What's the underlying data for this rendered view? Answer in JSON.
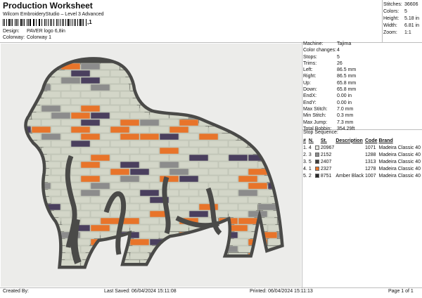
{
  "header": {
    "title": "Production Worksheet",
    "subtitle": "Wilcom EmbroideryStudio – Level 3 Advanced",
    "barcode_tail": ",1",
    "design_label": "Design:",
    "design_value": "PAVER logo 6,8in",
    "colorway_label": "Colorway:",
    "colorway_value": "Colorway 1"
  },
  "stats": [
    {
      "label": "Stitches:",
      "value": "36606"
    },
    {
      "label": "Colors:",
      "value": "5"
    },
    {
      "label": "Height:",
      "value": "5.18 in"
    },
    {
      "label": "Width:",
      "value": "6.81 in"
    },
    {
      "label": "Zoom:",
      "value": "1:1"
    }
  ],
  "machine_info": [
    {
      "label": "Machine:",
      "value": "Tajima"
    },
    {
      "label": "Color changes:",
      "value": "4"
    },
    {
      "label": "Stops:",
      "value": "5"
    },
    {
      "label": "Trims:",
      "value": "26"
    },
    {
      "label": "Left:",
      "value": "86.5 mm"
    },
    {
      "label": "Right:",
      "value": "86.5 mm"
    },
    {
      "label": "Up:",
      "value": "65.8 mm"
    },
    {
      "label": "Down:",
      "value": "65.8 mm"
    },
    {
      "label": "EndX:",
      "value": "0.00 in"
    },
    {
      "label": "EndY:",
      "value": "0.00 in"
    },
    {
      "label": "Max Stitch:",
      "value": "7.0 mm"
    },
    {
      "label": "Min Stitch:",
      "value": "0.3 mm"
    },
    {
      "label": "Max Jump:",
      "value": "7.3 mm"
    },
    {
      "label": "Total Bobbin:",
      "value": "354.29ft"
    }
  ],
  "stop_sequence": {
    "title": "Stop Sequence:",
    "columns": [
      "#",
      "N.",
      "St.",
      "Description",
      "Code",
      "Brand"
    ],
    "rows": [
      {
        "num": "1.",
        "n": "4",
        "color": "#e6e6e0",
        "st": "20967",
        "desc": "",
        "code": "1071",
        "brand": "Madeira Classic 40"
      },
      {
        "num": "2.",
        "n": "3",
        "color": "#8c8c8c",
        "st": "2152",
        "desc": "",
        "code": "1288",
        "brand": "Madeira Classic 40"
      },
      {
        "num": "3.",
        "n": "5",
        "color": "#3d3d3d",
        "st": "2407",
        "desc": "",
        "code": "1313",
        "brand": "Madeira Classic 40"
      },
      {
        "num": "4.",
        "n": "1",
        "color": "#e8742a",
        "st": "2327",
        "desc": "",
        "code": "1278",
        "brand": "Madeira Classic 40"
      },
      {
        "num": "5.",
        "n": "2",
        "color": "#2a2a2a",
        "st": "8751",
        "desc": "Amber Black",
        "code": "1007",
        "brand": "Madeira Classic 40"
      }
    ]
  },
  "footer": {
    "created_by": "Created By:",
    "last_saved": "Last Saved: 06/04/2024 15:11:08",
    "printed": "Printed: 06/04/2024 15:11:13",
    "page": "Page 1 of 1"
  },
  "colors": {
    "outline": "#4a4a48",
    "fill": "#d3d6c8",
    "orange": "#e8742a",
    "purple": "#4a3f5e",
    "gray": "#8c8c8c",
    "dark": "#3d3d3d"
  }
}
